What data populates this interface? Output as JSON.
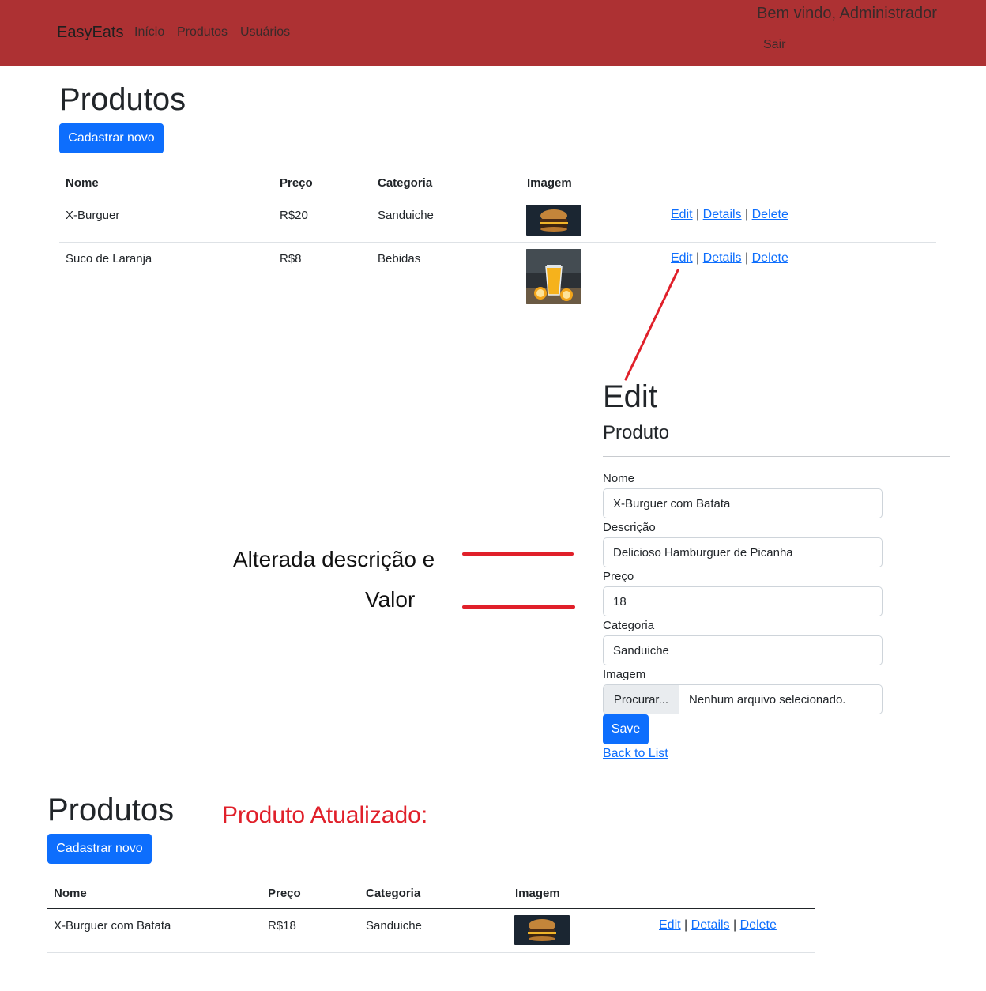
{
  "navbar": {
    "brand": "EasyEats",
    "links": [
      "Início",
      "Produtos",
      "Usuários"
    ],
    "welcome": "Bem vindo, Administrador",
    "logout": "Sair"
  },
  "list_top": {
    "title": "Produtos",
    "new_button": "Cadastrar novo",
    "headers": [
      "Nome",
      "Preço",
      "Categoria",
      "Imagem"
    ],
    "rows": [
      {
        "nome": "X-Burguer",
        "preco": "R$20",
        "categoria": "Sanduiche",
        "image": "burger-image"
      },
      {
        "nome": "Suco de Laranja",
        "preco": "R$8",
        "categoria": "Bebidas",
        "image": "orange-juice-image"
      }
    ],
    "actions": {
      "edit": "Edit",
      "details": "Details",
      "delete": "Delete",
      "sep": "|"
    }
  },
  "edit_form": {
    "title": "Edit",
    "subtitle": "Produto",
    "fields": {
      "nome": {
        "label": "Nome",
        "value": "X-Burguer com Batata"
      },
      "descricao": {
        "label": "Descrição",
        "value": "Delicioso Hamburguer de Picanha"
      },
      "preco": {
        "label": "Preço",
        "value": "18"
      },
      "categoria": {
        "label": "Categoria",
        "value": "Sanduiche"
      },
      "imagem": {
        "label": "Imagem",
        "button": "Procurar...",
        "status": "Nenhum arquivo selecionado."
      }
    },
    "save_button": "Save",
    "back_link": "Back to List"
  },
  "annotations": {
    "changed_line1": "Alterada descrição e",
    "changed_line2": "Valor",
    "updated": "Produto Atualizado:",
    "accent_color": "#e0202a"
  },
  "list_bottom": {
    "title": "Produtos",
    "new_button": "Cadastrar novo",
    "headers": [
      "Nome",
      "Preço",
      "Categoria",
      "Imagem"
    ],
    "rows": [
      {
        "nome": "X-Burguer com Batata",
        "preco": "R$18",
        "categoria": "Sanduiche",
        "image": "burger-image"
      }
    ],
    "actions": {
      "edit": "Edit",
      "details": "Details",
      "delete": "Delete",
      "sep": "|"
    }
  },
  "colors": {
    "navbar": "#ad3133",
    "primary": "#0d6efd"
  }
}
